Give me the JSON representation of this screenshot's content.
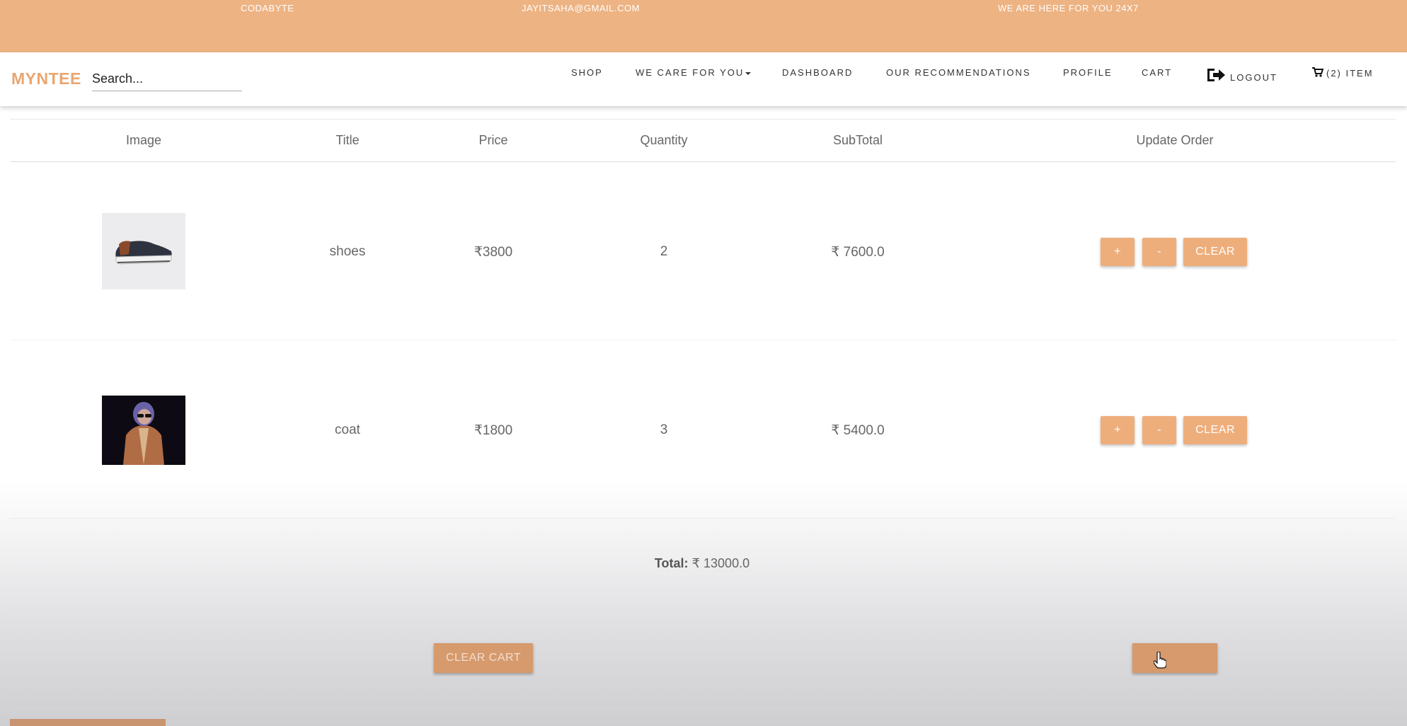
{
  "topbar": {
    "brand_name": "CODABYTE",
    "email": "JAYITSAHA@GMAIL.COM",
    "support": "WE ARE HERE FOR YOU 24X7"
  },
  "navbar": {
    "logo": "MYNTEE",
    "search_placeholder": "Search...",
    "items": {
      "shop": "SHOP",
      "we_care": "WE CARE FOR YOU",
      "dashboard": "DASHBOARD",
      "recommendations": "OUR RECOMMENDATIONS",
      "profile": "PROFILE",
      "cart": "CART",
      "logout": "LOGOUT",
      "cart_count": "(2) ITEM"
    }
  },
  "table": {
    "headers": {
      "image": "Image",
      "title": "Title",
      "price": "Price",
      "quantity": "Quantity",
      "subtotal": "SubTotal",
      "update": "Update Order"
    },
    "rows": [
      {
        "title": "shoes",
        "price": "₹3800",
        "quantity": "2",
        "subtotal": "₹ 7600.0",
        "image": "shoe-photo"
      },
      {
        "title": "coat",
        "price": "₹1800",
        "quantity": "3",
        "subtotal": "₹ 5400.0",
        "image": "coat-photo"
      }
    ],
    "buttons": {
      "plus": "+",
      "minus": "-",
      "clear": "CLEAR"
    }
  },
  "summary": {
    "total_label": "Total:",
    "total_value": "₹ 13000.0",
    "clear_cart": "CLEAR CART",
    "checkout": ""
  },
  "colors": {
    "accent": "#edb383",
    "button": "#eeae7c",
    "brand": "#e8a672"
  }
}
